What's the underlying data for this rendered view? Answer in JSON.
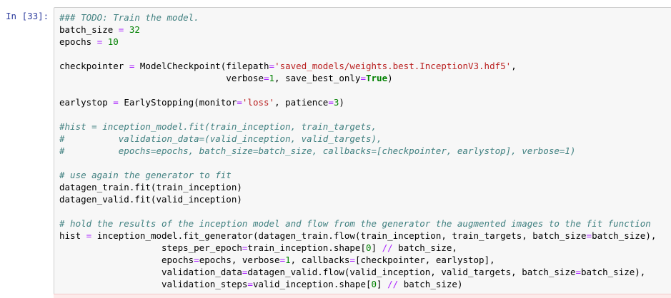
{
  "cell": {
    "prompt": "In [33]:",
    "lines": [
      [
        {
          "t": "### TODO: Train the model.",
          "c": "cm"
        }
      ],
      [
        {
          "t": "batch_size "
        },
        {
          "t": "=",
          "c": "op"
        },
        {
          "t": " "
        },
        {
          "t": "32",
          "c": "num"
        }
      ],
      [
        {
          "t": "epochs "
        },
        {
          "t": "=",
          "c": "op"
        },
        {
          "t": " "
        },
        {
          "t": "10",
          "c": "num"
        }
      ],
      [],
      [
        {
          "t": "checkpointer "
        },
        {
          "t": "=",
          "c": "op"
        },
        {
          "t": " ModelCheckpoint(filepath"
        },
        {
          "t": "=",
          "c": "op"
        },
        {
          "t": "'saved_models/weights.best.InceptionV3.hdf5'",
          "c": "str"
        },
        {
          "t": ","
        }
      ],
      [
        {
          "t": "                               verbose"
        },
        {
          "t": "=",
          "c": "op"
        },
        {
          "t": "1",
          "c": "num"
        },
        {
          "t": ", save_best_only"
        },
        {
          "t": "=",
          "c": "op"
        },
        {
          "t": "True",
          "c": "kw"
        },
        {
          "t": ")"
        }
      ],
      [],
      [
        {
          "t": "earlystop "
        },
        {
          "t": "=",
          "c": "op"
        },
        {
          "t": " EarlyStopping(monitor"
        },
        {
          "t": "=",
          "c": "op"
        },
        {
          "t": "'loss'",
          "c": "str"
        },
        {
          "t": ", patience"
        },
        {
          "t": "=",
          "c": "op"
        },
        {
          "t": "3",
          "c": "num"
        },
        {
          "t": ")"
        }
      ],
      [],
      [
        {
          "t": "#hist = inception_model.fit(train_inception, train_targets,",
          "c": "cm"
        }
      ],
      [
        {
          "t": "#          validation_data=(valid_inception, valid_targets),",
          "c": "cm"
        }
      ],
      [
        {
          "t": "#          epochs=epochs, batch_size=batch_size, callbacks=[checkpointer, earlystop], verbose=1)",
          "c": "cm"
        }
      ],
      [],
      [
        {
          "t": "# use again the generator to fit",
          "c": "cm"
        }
      ],
      [
        {
          "t": "datagen_train.fit(train_inception)"
        }
      ],
      [
        {
          "t": "datagen_valid.fit(valid_inception)"
        }
      ],
      [],
      [
        {
          "t": "# hold the results of the inception model and flow from the generator the augmented images to the fit function",
          "c": "cm"
        }
      ],
      [
        {
          "t": "hist "
        },
        {
          "t": "=",
          "c": "op"
        },
        {
          "t": " inception_model.fit_generator(datagen_train.flow(train_inception, train_targets, batch_size"
        },
        {
          "t": "=",
          "c": "op"
        },
        {
          "t": "batch_size),"
        }
      ],
      [
        {
          "t": "                   steps_per_epoch"
        },
        {
          "t": "=",
          "c": "op"
        },
        {
          "t": "train_inception.shape["
        },
        {
          "t": "0",
          "c": "num"
        },
        {
          "t": "] "
        },
        {
          "t": "//",
          "c": "op"
        },
        {
          "t": " batch_size,"
        }
      ],
      [
        {
          "t": "                   epochs"
        },
        {
          "t": "=",
          "c": "op"
        },
        {
          "t": "epochs, verbose"
        },
        {
          "t": "=",
          "c": "op"
        },
        {
          "t": "1",
          "c": "num"
        },
        {
          "t": ", callbacks"
        },
        {
          "t": "=",
          "c": "op"
        },
        {
          "t": "[checkpointer, earlystop],"
        }
      ],
      [
        {
          "t": "                   validation_data"
        },
        {
          "t": "=",
          "c": "op"
        },
        {
          "t": "datagen_valid.flow(valid_inception, valid_targets, batch_size"
        },
        {
          "t": "=",
          "c": "op"
        },
        {
          "t": "batch_size),"
        }
      ],
      [
        {
          "t": "                   validation_steps"
        },
        {
          "t": "=",
          "c": "op"
        },
        {
          "t": "valid_inception.shape["
        },
        {
          "t": "0",
          "c": "num"
        },
        {
          "t": "] "
        },
        {
          "t": "//",
          "c": "op"
        },
        {
          "t": " batch_size)"
        }
      ]
    ]
  },
  "colors": {
    "prompt": "#303f9f",
    "comment": "#408080",
    "string": "#ba2121",
    "number": "#008000",
    "operator": "#aa22ff",
    "keyword": "#008000",
    "cell_background": "#f7f7f7"
  }
}
